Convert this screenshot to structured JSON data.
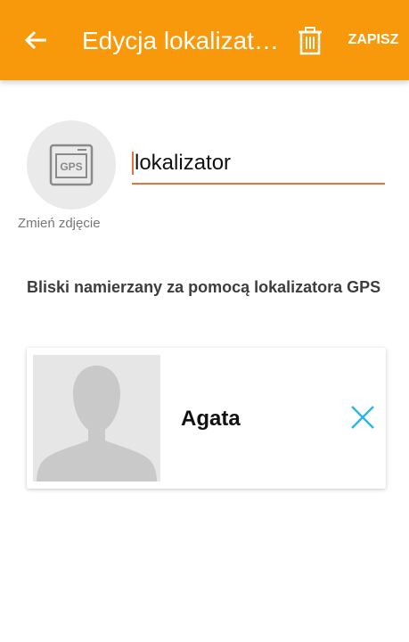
{
  "appbar": {
    "title": "Edycja lokalizatora",
    "save_label": "ZAPISZ",
    "icons": {
      "back": "arrow-back-icon",
      "delete": "trash-icon"
    },
    "color": "#f7990b"
  },
  "device": {
    "photo_icon": "gps-device-icon",
    "photo_icon_text": "GPS",
    "change_photo_label": "Zmień zdjęcie",
    "name_value": "lokalizator",
    "accent": "#e8703a"
  },
  "section": {
    "heading": "Bliski namierzany za pomocą lokalizatora GPS"
  },
  "people": [
    {
      "name": "Agata",
      "avatar_icon": "person-placeholder-icon",
      "remove_icon": "close-icon",
      "remove_color": "#29b6e6"
    }
  ]
}
